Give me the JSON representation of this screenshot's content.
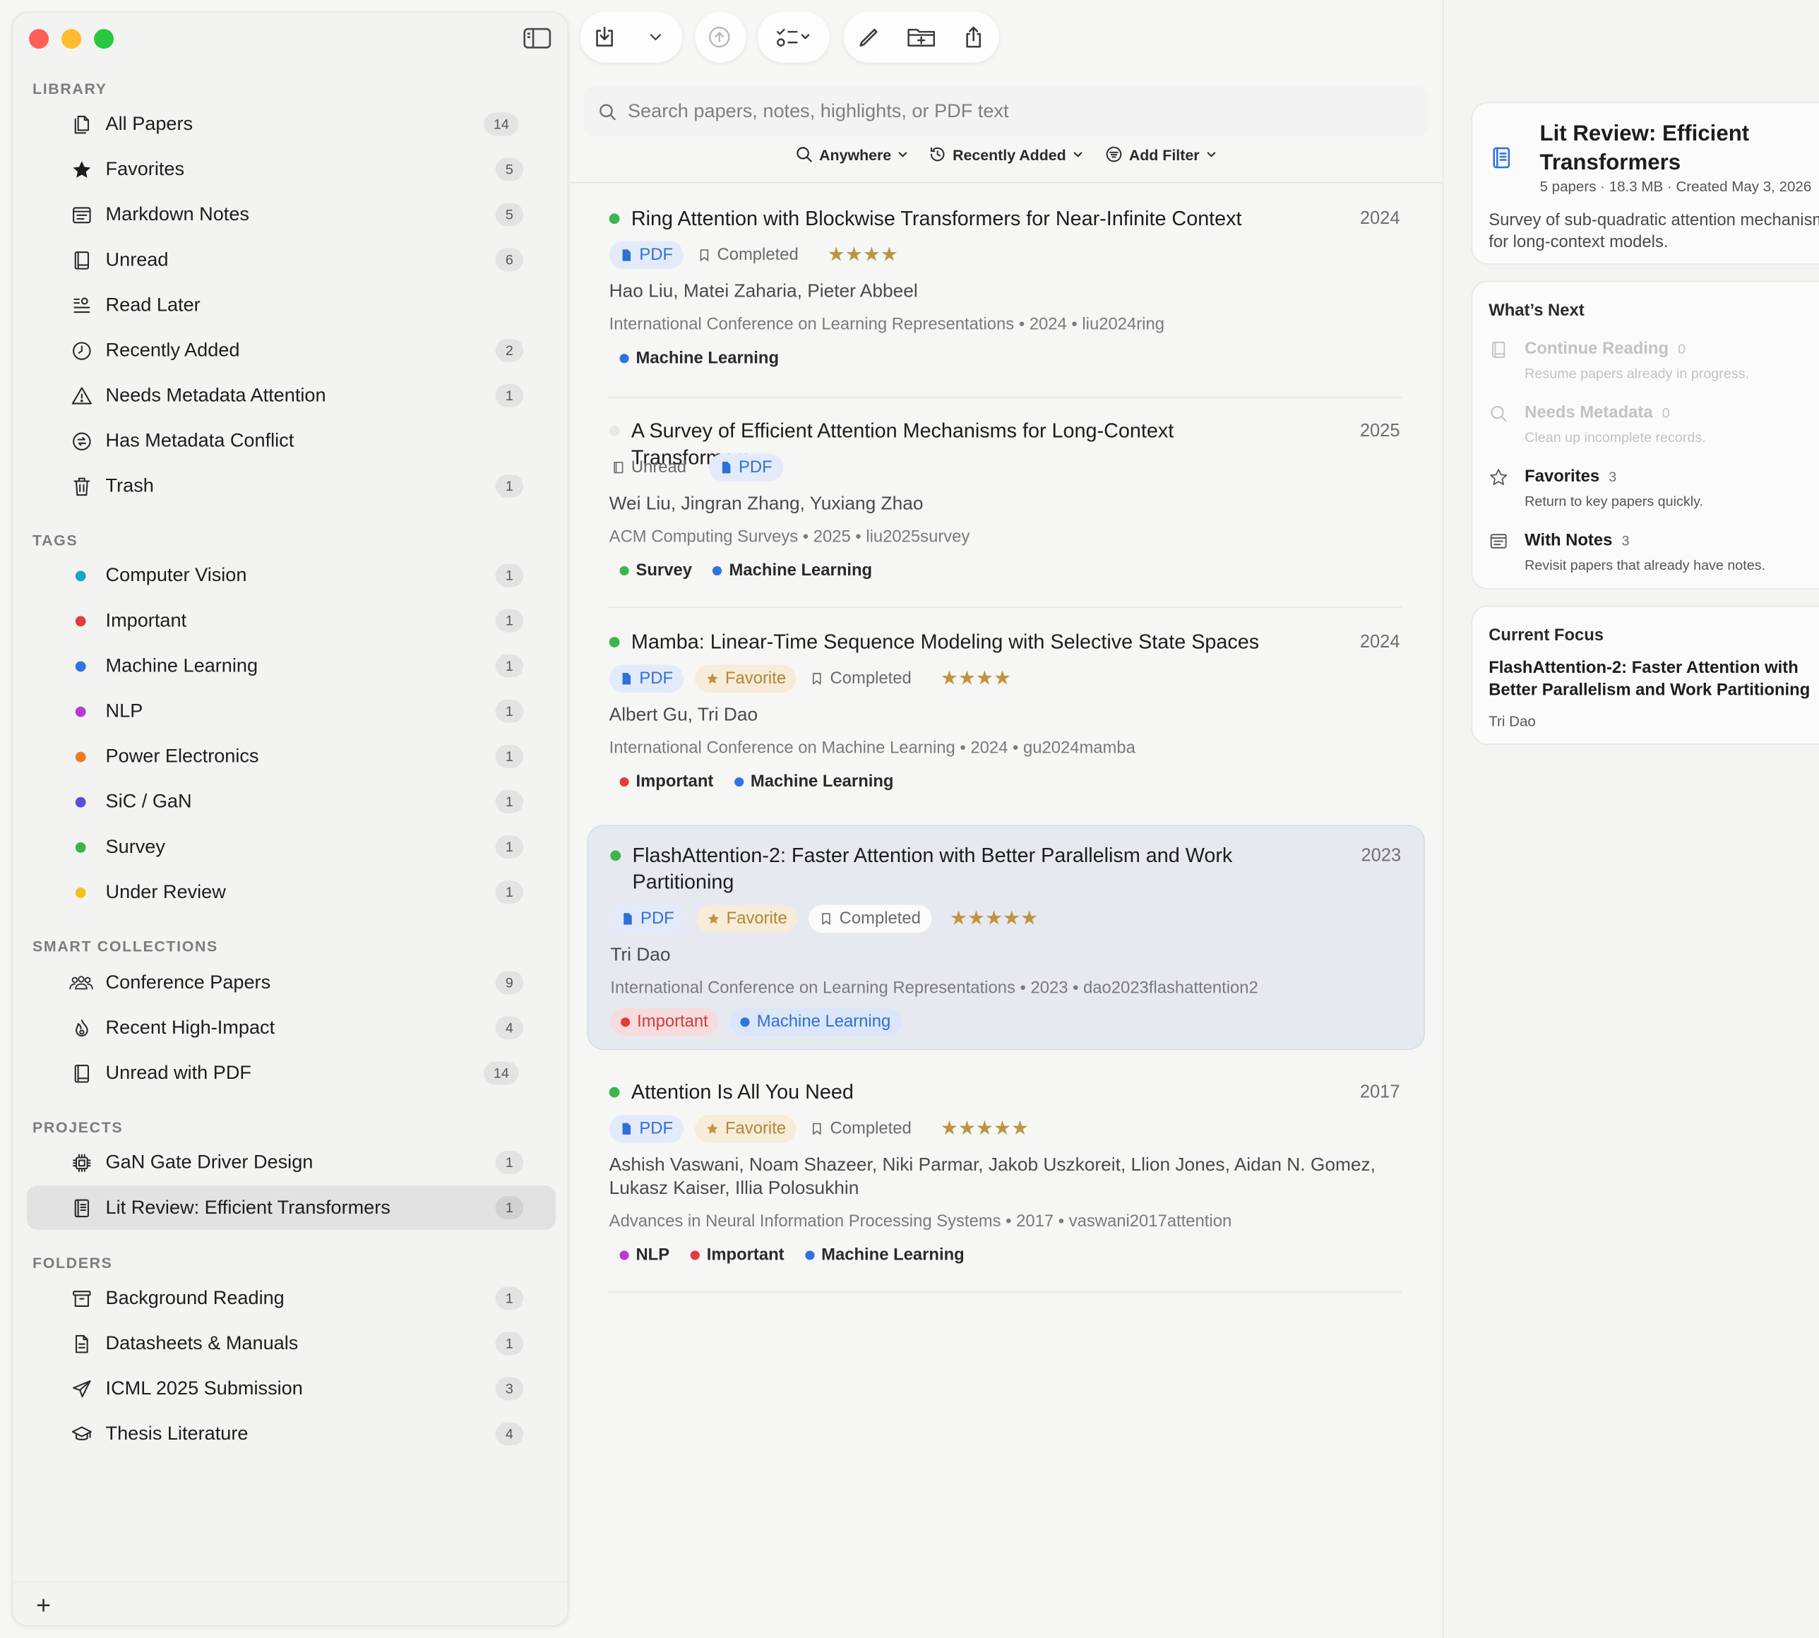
{
  "sidebar": {
    "library_title": "LIBRARY",
    "library": [
      {
        "label": "All Papers",
        "count": "14",
        "icon": "all-papers-icon"
      },
      {
        "label": "Favorites",
        "count": "5",
        "icon": "star-icon"
      },
      {
        "label": "Markdown Notes",
        "count": "5",
        "icon": "notes-icon"
      },
      {
        "label": "Unread",
        "count": "6",
        "icon": "book-icon"
      },
      {
        "label": "Read Later",
        "count": "",
        "icon": "read-later-icon"
      },
      {
        "label": "Recently Added",
        "count": "2",
        "icon": "clock-icon"
      },
      {
        "label": "Needs Metadata Attention",
        "count": "1",
        "icon": "warning-icon"
      },
      {
        "label": "Has Metadata Conflict",
        "count": "",
        "icon": "conflict-icon"
      },
      {
        "label": "Trash",
        "count": "1",
        "icon": "trash-icon"
      }
    ],
    "tags_title": "TAGS",
    "tags": [
      {
        "label": "Computer Vision",
        "count": "1",
        "color": "#1aa3c4"
      },
      {
        "label": "Important",
        "count": "1",
        "color": "#e23c3c"
      },
      {
        "label": "Machine Learning",
        "count": "1",
        "color": "#2f72e0"
      },
      {
        "label": "NLP",
        "count": "1",
        "color": "#b83ad1"
      },
      {
        "label": "Power Electronics",
        "count": "1",
        "color": "#f07c20"
      },
      {
        "label": "SiC / GaN",
        "count": "1",
        "color": "#5a4fd6"
      },
      {
        "label": "Survey",
        "count": "1",
        "color": "#3cb54a"
      },
      {
        "label": "Under Review",
        "count": "1",
        "color": "#f2c21b"
      }
    ],
    "smart_title": "SMART COLLECTIONS",
    "smart": [
      {
        "label": "Conference Papers",
        "count": "9",
        "icon": "people-icon"
      },
      {
        "label": "Recent High-Impact",
        "count": "4",
        "icon": "flame-icon"
      },
      {
        "label": "Unread with PDF",
        "count": "14",
        "icon": "book-icon"
      }
    ],
    "projects_title": "PROJECTS",
    "projects": [
      {
        "label": "GaN Gate Driver Design",
        "count": "1",
        "icon": "chip-icon"
      },
      {
        "label": "Lit Review: Efficient Transformers",
        "count": "1",
        "icon": "project-book-icon"
      }
    ],
    "folders_title": "FOLDERS",
    "folders": [
      {
        "label": "Background Reading",
        "count": "1",
        "icon": "archive-icon"
      },
      {
        "label": "Datasheets & Manuals",
        "count": "1",
        "icon": "document-icon"
      },
      {
        "label": "ICML 2025 Submission",
        "count": "3",
        "icon": "send-icon"
      },
      {
        "label": "Thesis Literature",
        "count": "4",
        "icon": "graduation-cap-icon"
      }
    ],
    "add_label": "+"
  },
  "search": {
    "placeholder": "Search papers, notes, highlights, or PDF text",
    "filters": [
      "Anywhere",
      "Recently Added",
      "Add Filter"
    ]
  },
  "papers": [
    {
      "title": "Ring Attention with Blockwise Transformers for Near-Infinite Context",
      "year": "2024",
      "dot": "#3cb54a",
      "pdf": "PDF",
      "favorite": "",
      "status": "Completed",
      "stars": "★★★★",
      "authors": "Hao Liu, Matei Zaharia, Pieter Abbeel",
      "venue": "International Conference on Learning Representations • 2024 • liu2024ring",
      "tags": [
        {
          "label": "Machine Learning",
          "color": "#2f72e0"
        }
      ]
    },
    {
      "title": "A Survey of Efficient Attention Mechanisms for Long-Context Transformers",
      "year": "2025",
      "dot": "#e8e8e8",
      "pdf": "PDF",
      "favorite": "",
      "status": "Unread",
      "stars": "",
      "authors": "Wei Liu, Jingran Zhang, Yuxiang Zhao",
      "venue": "ACM Computing Surveys • 2025 • liu2025survey",
      "tags": [
        {
          "label": "Survey",
          "color": "#3cb54a"
        },
        {
          "label": "Machine Learning",
          "color": "#2f72e0"
        }
      ]
    },
    {
      "title": "Mamba: Linear-Time Sequence Modeling with Selective State Spaces",
      "year": "2024",
      "dot": "#3cb54a",
      "pdf": "PDF",
      "favorite": "Favorite",
      "status": "Completed",
      "stars": "★★★★",
      "authors": "Albert Gu, Tri Dao",
      "venue": "International Conference on Machine Learning • 2024 • gu2024mamba",
      "tags": [
        {
          "label": "Important",
          "color": "#e23c3c"
        },
        {
          "label": "Machine Learning",
          "color": "#2f72e0"
        }
      ]
    },
    {
      "title": "FlashAttention-2: Faster Attention with Better Parallelism and Work Partitioning",
      "year": "2023",
      "dot": "#3cb54a",
      "pdf": "PDF",
      "favorite": "Favorite",
      "status": "Completed",
      "stars": "★★★★★",
      "authors": "Tri Dao",
      "venue": "International Conference on Learning Representations • 2023 • dao2023flashattention2",
      "tags": [
        {
          "label": "Important",
          "color": "#e23c3c"
        },
        {
          "label": "Machine Learning",
          "color": "#2f72e0"
        }
      ]
    },
    {
      "title": "Attention Is All You Need",
      "year": "2017",
      "dot": "#3cb54a",
      "pdf": "PDF",
      "favorite": "Favorite",
      "status": "Completed",
      "stars": "★★★★★",
      "authors": "Ashish Vaswani, Noam Shazeer, Niki Parmar, Jakob Uszkoreit, Llion Jones, Aidan N. Gomez, Lukasz Kaiser, Illia Polosukhin",
      "venue": "Advances in Neural Information Processing Systems • 2017 • vaswani2017attention",
      "tags": [
        {
          "label": "NLP",
          "color": "#b83ad1"
        },
        {
          "label": "Important",
          "color": "#e23c3c"
        },
        {
          "label": "Machine Learning",
          "color": "#2f72e0"
        }
      ]
    }
  ],
  "project_card": {
    "title": "Lit Review: Efficient Transformers",
    "meta": "5 papers · 18.3 MB · Created May 3, 2026",
    "description": "Survey of sub-quadratic attention mechanisms for long-context models."
  },
  "whats_next": {
    "title": "What’s Next",
    "items": [
      {
        "name": "Continue Reading",
        "count": "0",
        "sub": "Resume papers already in progress.",
        "icon": "book-icon"
      },
      {
        "name": "Needs Metadata",
        "count": "0",
        "sub": "Clean up incomplete records.",
        "icon": "magnifier-icon"
      },
      {
        "name": "Favorites",
        "count": "3",
        "sub": "Return to key papers quickly.",
        "icon": "star-outline-icon"
      },
      {
        "name": "With Notes",
        "count": "3",
        "sub": "Revisit papers that already have notes.",
        "icon": "notes-icon"
      }
    ]
  },
  "current_focus": {
    "title": "Current Focus",
    "paper": "FlashAttention-2: Faster Attention with Better Parallelism and Work Partitioning",
    "author": "Tri Dao"
  }
}
